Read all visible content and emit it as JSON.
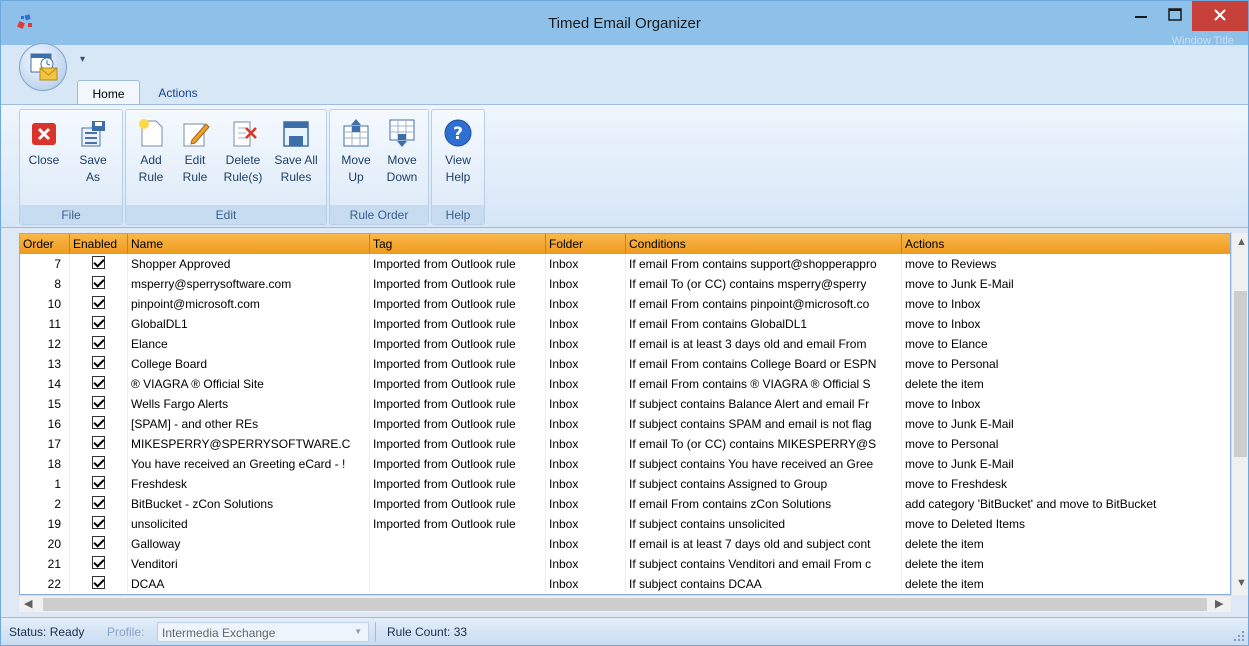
{
  "window": {
    "title": "Timed Email Organizer",
    "ghost_text": "Window Title"
  },
  "tabs": [
    {
      "label": "Home"
    },
    {
      "label": "Actions"
    }
  ],
  "ribbon": {
    "groups": [
      {
        "label": "File",
        "buttons": [
          {
            "label": "Close"
          },
          {
            "label": "Save\nAs"
          }
        ]
      },
      {
        "label": "Edit",
        "buttons": [
          {
            "label": "Add\nRule"
          },
          {
            "label": "Edit\nRule"
          },
          {
            "label": "Delete\nRule(s)"
          },
          {
            "label": "Save All\nRules"
          }
        ]
      },
      {
        "label": "Rule Order",
        "buttons": [
          {
            "label": "Move\nUp"
          },
          {
            "label": "Move\nDown"
          }
        ]
      },
      {
        "label": "Help",
        "buttons": [
          {
            "label": "View\nHelp"
          }
        ]
      }
    ]
  },
  "grid": {
    "columns": [
      "Order",
      "Enabled",
      "Name",
      "Tag",
      "Folder",
      "Conditions",
      "Actions"
    ],
    "rows": [
      {
        "order": "7",
        "enabled": true,
        "name": "Shopper Approved",
        "tag": "Imported from Outlook rule",
        "folder": "Inbox",
        "conditions": "If email From contains support@shopperappro",
        "actions": "move to Reviews"
      },
      {
        "order": "8",
        "enabled": true,
        "name": "msperry@sperrysoftware.com",
        "tag": "Imported from Outlook rule",
        "folder": "Inbox",
        "conditions": "If email To (or CC) contains msperry@sperry",
        "actions": "move to Junk E-Mail"
      },
      {
        "order": "10",
        "enabled": true,
        "name": "pinpoint@microsoft.com",
        "tag": "Imported from Outlook rule",
        "folder": "Inbox",
        "conditions": "If email From contains pinpoint@microsoft.co",
        "actions": "move to Inbox"
      },
      {
        "order": "11",
        "enabled": true,
        "name": "GlobalDL1",
        "tag": "Imported from Outlook rule",
        "folder": "Inbox",
        "conditions": "If email From contains GlobalDL1",
        "actions": "move to Inbox"
      },
      {
        "order": "12",
        "enabled": true,
        "name": "Elance",
        "tag": "Imported from Outlook rule",
        "folder": "Inbox",
        "conditions": "If email is at least 3 days old and email From",
        "actions": "move to Elance"
      },
      {
        "order": "13",
        "enabled": true,
        "name": "College Board",
        "tag": "Imported from Outlook rule",
        "folder": "Inbox",
        "conditions": "If email From contains College Board or ESPN",
        "actions": "move to Personal"
      },
      {
        "order": "14",
        "enabled": true,
        "name": "® VIAGRA ® Official Site",
        "tag": "Imported from Outlook rule",
        "folder": "Inbox",
        "conditions": "If email From contains ® VIAGRA ® Official S",
        "actions": "delete the item"
      },
      {
        "order": "15",
        "enabled": true,
        "name": "Wells Fargo Alerts",
        "tag": "Imported from Outlook rule",
        "folder": "Inbox",
        "conditions": "If subject contains Balance Alert and email Fr",
        "actions": "move to Inbox"
      },
      {
        "order": "16",
        "enabled": true,
        "name": "[SPAM] - and other REs",
        "tag": "Imported from Outlook rule",
        "folder": "Inbox",
        "conditions": "If subject contains SPAM and email is not flag",
        "actions": "move to Junk E-Mail"
      },
      {
        "order": "17",
        "enabled": true,
        "name": "MIKESPERRY@SPERRYSOFTWARE.C",
        "tag": "Imported from Outlook rule",
        "folder": "Inbox",
        "conditions": "If email To (or CC) contains MIKESPERRY@S",
        "actions": "move to Personal"
      },
      {
        "order": "18",
        "enabled": true,
        "name": "You have received an Greeting eCard - !",
        "tag": "Imported from Outlook rule",
        "folder": "Inbox",
        "conditions": "If subject contains You have received an Gree",
        "actions": "move to Junk E-Mail"
      },
      {
        "order": "1",
        "enabled": true,
        "name": "Freshdesk",
        "tag": "Imported from Outlook rule",
        "folder": "Inbox",
        "conditions": "If subject contains Assigned to Group",
        "actions": "move to Freshdesk"
      },
      {
        "order": "2",
        "enabled": true,
        "name": "BitBucket - zCon Solutions",
        "tag": "Imported from Outlook rule",
        "folder": "Inbox",
        "conditions": "If email From contains zCon Solutions",
        "actions": "add category 'BitBucket' and move to BitBucket"
      },
      {
        "order": "19",
        "enabled": true,
        "name": "unsolicited",
        "tag": "Imported from Outlook rule",
        "folder": "Inbox",
        "conditions": "If subject contains unsolicited",
        "actions": "move to Deleted Items"
      },
      {
        "order": "20",
        "enabled": true,
        "name": "Galloway",
        "tag": "",
        "folder": "Inbox",
        "conditions": "If email is at least 7 days old and subject cont",
        "actions": "delete the item"
      },
      {
        "order": "21",
        "enabled": true,
        "name": "Venditori",
        "tag": "",
        "folder": "Inbox",
        "conditions": "If subject contains Venditori and email From c",
        "actions": "delete the item"
      },
      {
        "order": "22",
        "enabled": true,
        "name": "DCAA",
        "tag": "",
        "folder": "Inbox",
        "conditions": "If subject contains DCAA",
        "actions": "delete the item"
      }
    ]
  },
  "status": {
    "state": "Status: Ready",
    "profile_label": "Profile:",
    "profile_value": "Intermedia Exchange",
    "rule_count": "Rule Count: 33"
  }
}
